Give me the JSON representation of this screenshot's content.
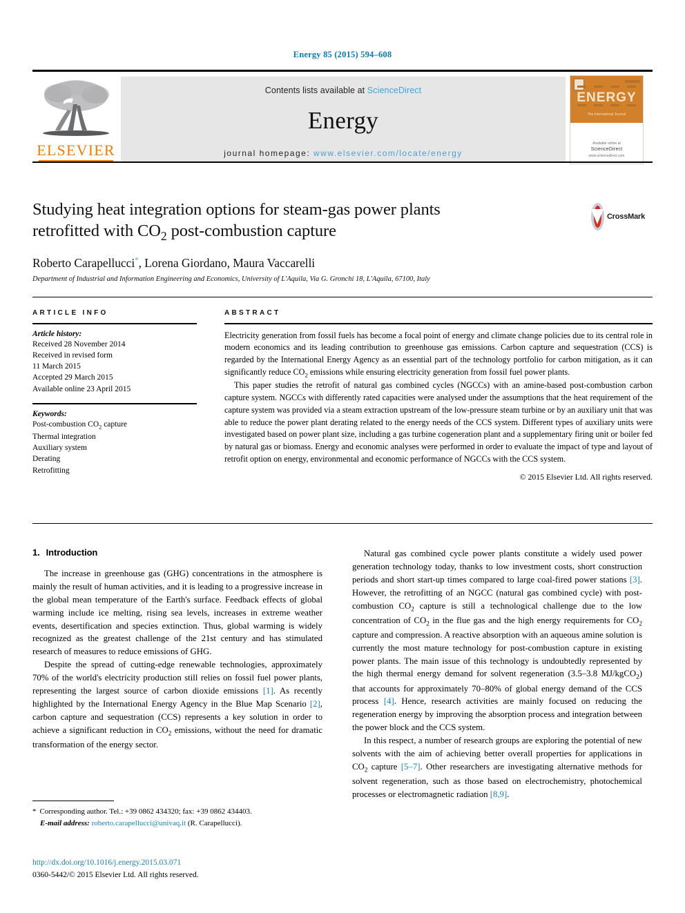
{
  "running_head": "Energy 85 (2015) 594–608",
  "masthead": {
    "contents_prefix": "Contents lists available at ",
    "sciencedirect": "ScienceDirect",
    "journal_name": "Energy",
    "homepage_prefix": "journal homepage: ",
    "homepage_url": "www.elsevier.com/locate/energy",
    "publisher": "ELSEVIER",
    "publisher_logo_icon": "elsevier-tree-icon",
    "cover": {
      "title": "ENERGY",
      "subtitle": "The International Journal",
      "footer_line1": "Available online at",
      "footer_line2": "ScienceDirect",
      "footer_line3": "www.sciencedirect.com"
    }
  },
  "article": {
    "title_line1": "Studying heat integration options for steam-gas power plants",
    "title_line2_a": "retrofitted with CO",
    "title_line2_sub": "2",
    "title_line2_b": " post-combustion capture",
    "authors_a": "Roberto Carapellucci",
    "authors_star": "*",
    "authors_b": ", Lorena Giordano, Maura Vaccarelli",
    "affiliation": "Department of Industrial and Information Engineering and Economics, University of L'Aquila, Via G. Gronchi 18, L'Aquila, 67100, Italy",
    "crossmark_label": "CrossMark"
  },
  "info": {
    "heading": "ARTICLE INFO",
    "history_label": "Article history:",
    "history": [
      "Received 28 November 2014",
      "Received in revised form",
      "11 March 2015",
      "Accepted 29 March 2015",
      "Available online 23 April 2015"
    ],
    "keywords_label": "Keywords:",
    "keywords": [
      "Post-combustion CO2 capture",
      "Thermal integration",
      "Auxiliary system",
      "Derating",
      "Retrofitting"
    ],
    "keyword_first_a": "Post-combustion CO",
    "keyword_first_sub": "2",
    "keyword_first_b": " capture"
  },
  "abstract": {
    "heading": "ABSTRACT",
    "p1_a": "Electricity generation from fossil fuels has become a focal point of energy and climate change policies due to its central role in modern economics and its leading contribution to greenhouse gas emissions. Carbon capture and sequestration (CCS) is regarded by the International Energy Agency as an essential part of the technology portfolio for carbon mitigation, as it can significantly reduce CO",
    "p1_sub": "2",
    "p1_b": " emissions while ensuring electricity generation from fossil fuel power plants.",
    "p2": "This paper studies the retrofit of natural gas combined cycles (NGCCs) with an amine-based post-combustion carbon capture system. NGCCs with differently rated capacities were analysed under the assumptions that the heat requirement of the capture system was provided via a steam extraction upstream of the low-pressure steam turbine or by an auxiliary unit that was able to reduce the power plant derating related to the energy needs of the CCS system. Different types of auxiliary units were investigated based on power plant size, including a gas turbine cogeneration plant and a supplementary firing unit or boiler fed by natural gas or biomass. Energy and economic analyses were performed in order to evaluate the impact of type and layout of retrofit option on energy, environmental and economic performance of NGCCs with the CCS system.",
    "copyright": "© 2015 Elsevier Ltd. All rights reserved."
  },
  "body": {
    "section_number": "1.",
    "section_title": "Introduction",
    "left": {
      "p1": "The increase in greenhouse gas (GHG) concentrations in the atmosphere is mainly the result of human activities, and it is leading to a progressive increase in the global mean temperature of the Earth's surface. Feedback effects of global warming include ice melting, rising sea levels, increases in extreme weather events, desertification and species extinction. Thus, global warming is widely recognized as the greatest challenge of the 21st century and has stimulated research of measures to reduce emissions of GHG.",
      "p2_a": "Despite the spread of cutting-edge renewable technologies, approximately 70% of the world's electricity production still relies on fossil fuel power plants, representing the largest source of carbon dioxide emissions ",
      "p2_cite1": "[1]",
      "p2_b": ". As recently highlighted by the International Energy Agency in the Blue Map Scenario ",
      "p2_cite2": "[2]",
      "p2_c": ", carbon capture and sequestration (CCS) represents a key solution in order to achieve a significant reduction in CO",
      "p2_sub": "2",
      "p2_d": " emissions, without the need for dramatic transformation of the energy sector."
    },
    "right": {
      "p1_a": "Natural gas combined cycle power plants constitute a widely used power generation technology today, thanks to low investment costs, short construction periods and short start-up times compared to large coal-fired power stations ",
      "p1_cite": "[3]",
      "p1_b": ". However, the retrofitting of an NGCC (natural gas combined cycle) with post-combustion CO",
      "p1_sub1": "2",
      "p1_c": " capture is still a technological challenge due to the low concentration of CO",
      "p1_sub2": "2",
      "p1_d": " in the flue gas and the high energy requirements for CO",
      "p1_sub3": "2",
      "p1_e": " capture and compression. A reactive absorption with an aqueous amine solution is currently the most mature technology for post-combustion capture in existing power plants. The main issue of this technology is undoubtedly represented by the high thermal energy demand for solvent regeneration (3.5–3.8 MJ/kgCO",
      "p1_sub4": "2",
      "p1_f": ") that accounts for approximately 70–80% of global energy demand of the CCS process ",
      "p1_cite2": "[4]",
      "p1_g": ". Hence, research activities are mainly focused on reducing the regeneration energy by improving the absorption process and integration between the power block and the CCS system.",
      "p2_a": "In this respect, a number of research groups are exploring the potential of new solvents with the aim of achieving better overall properties for applications in CO",
      "p2_sub": "2",
      "p2_b": " capture ",
      "p2_cite1": "[5–7]",
      "p2_c": ". Other researchers are investigating alternative methods for solvent regeneration, such as those based on electrochemistry, photochemical processes or electromagnetic radiation ",
      "p2_cite2": "[8,9]",
      "p2_d": "."
    }
  },
  "footnote": {
    "star": "*",
    "corresponding": "Corresponding author. Tel.: +39 0862 434320; fax: +39 0862 434403.",
    "email_label": "E-mail address:",
    "email": "roberto.carapellucci@univaq.it",
    "email_owner": "(R. Carapellucci)."
  },
  "footer": {
    "doi": "http://dx.doi.org/10.1016/j.energy.2015.03.071",
    "issn_line": "0360-5442/© 2015 Elsevier Ltd. All rights reserved."
  },
  "colors": {
    "link": "#1a7fb5",
    "elsevier_orange": "#ef7d00",
    "masthead_bg": "#e6e6e6",
    "cover_orange": "#d2812a",
    "crossmark_red": "#d6291f"
  }
}
